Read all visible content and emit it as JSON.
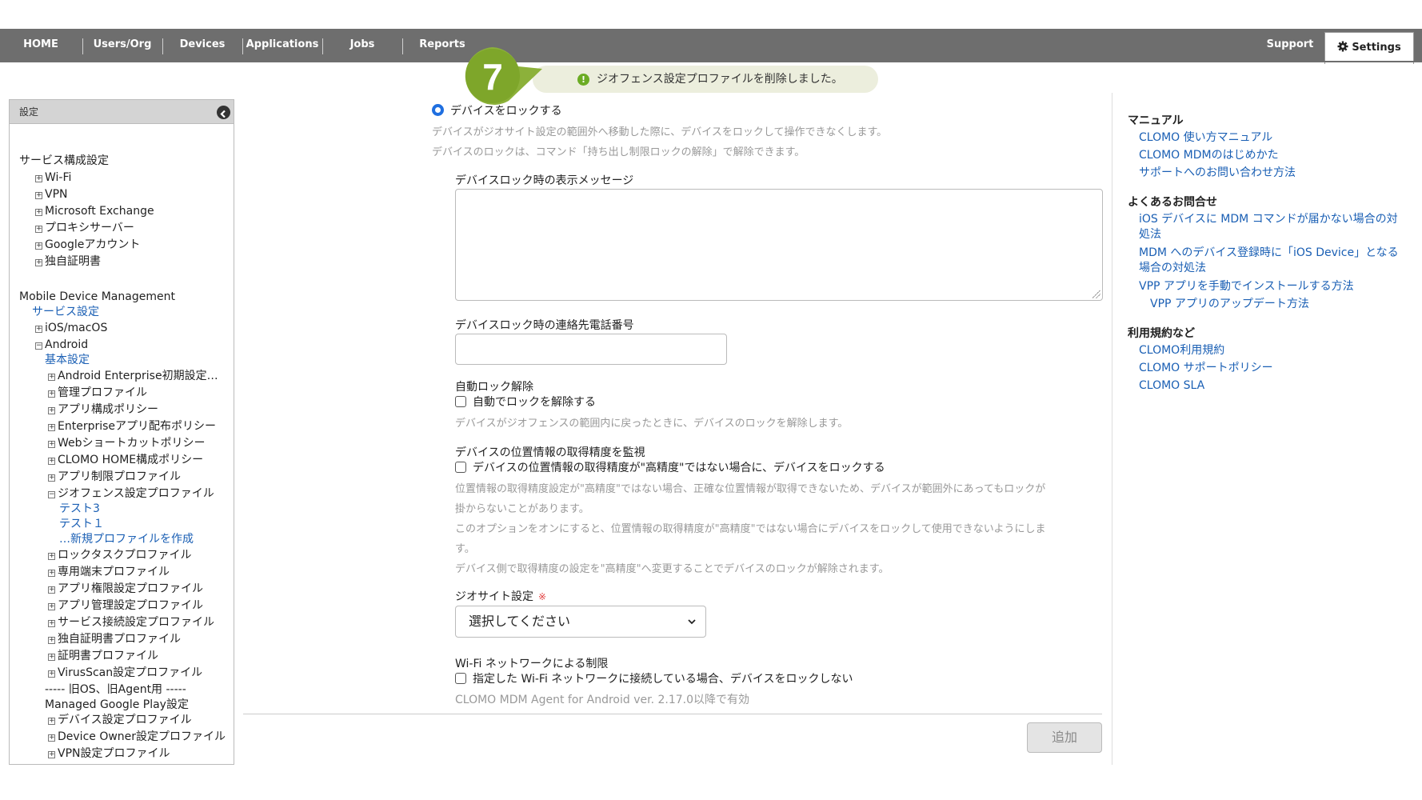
{
  "nav": {
    "items": [
      "HOME",
      "Users/Org",
      "Devices",
      "Applications",
      "Jobs",
      "Reports"
    ],
    "support": "Support",
    "settings": "Settings"
  },
  "step": {
    "number": "7",
    "color": "#7ea62a"
  },
  "toast": {
    "message": "ジオフェンス設定プロファイルを削除しました。"
  },
  "sidebar": {
    "title": "設定",
    "service_config": "サービス構成設定",
    "service_items": [
      "Wi-Fi",
      "VPN",
      "Microsoft Exchange",
      "プロキシサーバー",
      "Googleアカウント",
      "独自証明書"
    ],
    "mdm_title": "Mobile Device Management",
    "service_settings": "サービス設定",
    "ios_macos": "iOS/macOS",
    "android": "Android",
    "basic_settings": "基本設定",
    "android_items_a": [
      "Android Enterprise初期設定…",
      "管理プロファイル",
      "アプリ構成ポリシー",
      "Enterpriseアプリ配布ポリシー",
      "Webショートカットポリシー",
      "CLOMO HOME構成ポリシー",
      "アプリ制限プロファイル"
    ],
    "geofence": "ジオフェンス設定プロファイル",
    "geofence_children": [
      "テスト3",
      "テスト１",
      "…新規プロファイルを作成"
    ],
    "android_items_b": [
      "ロックタスクプロファイル",
      "専用端末プロファイル",
      "アプリ権限設定プロファイル",
      "アプリ管理設定プロファイル",
      "サービス接続設定プロファイル",
      "独自証明書プロファイル",
      "証明書プロファイル",
      "VirusScan設定プロファイル"
    ],
    "old_os": "----- 旧OS、旧Agent用 -----",
    "managed_gp": "Managed Google Play設定",
    "android_items_c": [
      "デバイス設定プロファイル",
      "Device Owner設定プロファイル",
      "VPN設定プロファイル"
    ]
  },
  "main": {
    "lock_radio_label": "デバイスをロックする",
    "lock_hint1": "デバイスがジオサイト設定の範囲外へ移動した際に、デバイスをロックして操作できなくします。",
    "lock_hint2": "デバイスのロックは、コマンド「持ち出し制限ロックの解除」で解除できます。",
    "lock_message_label": "デバイスロック時の表示メッセージ",
    "lock_phone_label": "デバイスロック時の連絡先電話番号",
    "auto_unlock_label": "自動ロック解除",
    "auto_unlock_check": "自動でロックを解除する",
    "auto_unlock_hint": "デバイスがジオフェンスの範囲内に戻ったときに、デバイスのロックを解除します。",
    "accuracy_label": "デバイスの位置情報の取得精度を監視",
    "accuracy_check": "デバイスの位置情報の取得精度が\"高精度\"ではない場合に、デバイスをロックする",
    "accuracy_hint1a": "位置情報の取得精度設定が\"高精度\"ではない場合、正確な位置情報が取得できないため、デバイスが範囲外にあってもロックが",
    "accuracy_hint1b": "掛からないことがあります。",
    "accuracy_hint2a": "このオプションをオンにすると、位置情報の取得精度が\"高精度\"ではない場合にデバイスをロックして使用できないようにしま",
    "accuracy_hint2b": "す。",
    "accuracy_hint3": "デバイス側で取得精度の設定を\"高精度\"へ変更することでデバイスのロックが解除されます。",
    "geosite_label": "ジオサイト設定",
    "required_mark": "※",
    "geosite_select": "選択してください",
    "wifi_label": "Wi-Fi ネットワークによる制限",
    "wifi_check": "指定した Wi-Fi ネットワークに接続している場合、デバイスをロックしない",
    "wifi_hint": "CLOMO MDM Agent for Android ver. 2.17.0以降で有効",
    "add_button": "追加"
  },
  "right": {
    "manual_title": "マニュアル",
    "manual_links": [
      "CLOMO 使い方マニュアル",
      "CLOMO MDMのはじめかた",
      "サポートへのお問い合わせ方法"
    ],
    "faq_title": "よくあるお問合せ",
    "faq_links": [
      "iOS デバイスに MDM コマンドが届かない場合の対処法",
      "MDM へのデバイス登録時に「iOS Device」となる場合の対処法",
      "VPP アプリを手動でインストールする方法"
    ],
    "faq_sublink": "VPP アプリのアップデート方法",
    "terms_title": "利用規約など",
    "terms_links": [
      "CLOMO利用規約",
      "CLOMO サポートポリシー",
      "CLOMO SLA"
    ]
  }
}
